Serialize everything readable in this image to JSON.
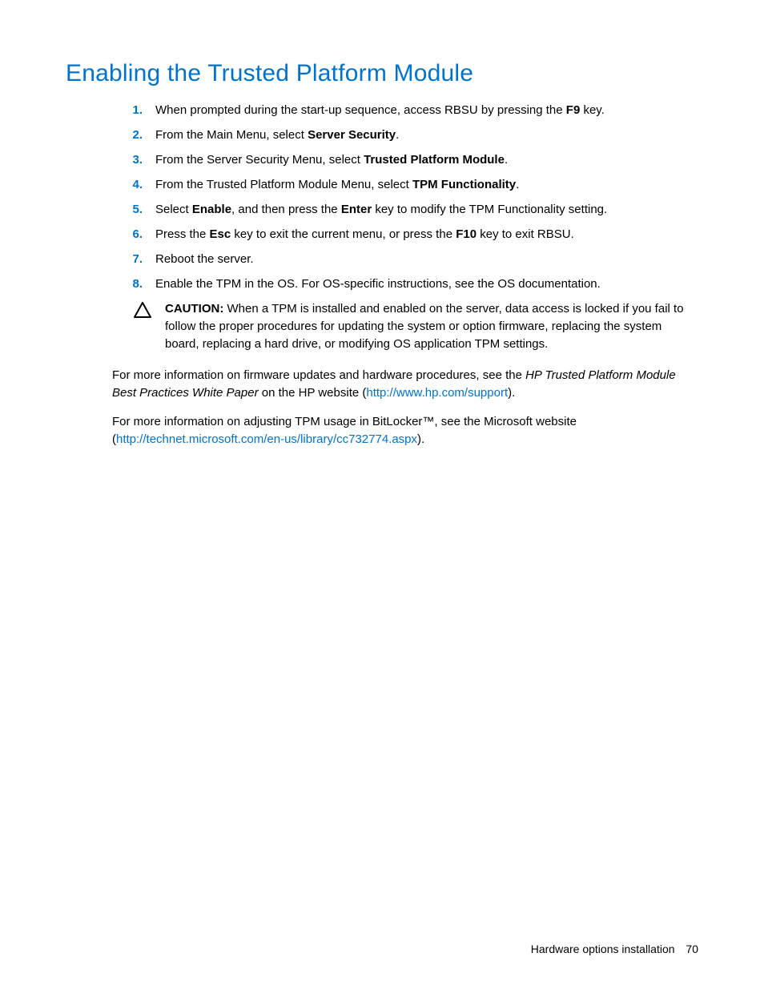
{
  "title": "Enabling the Trusted Platform Module",
  "steps": {
    "s1": {
      "num": "1.",
      "pre": "When prompted during the start-up sequence, access RBSU by pressing the ",
      "b1": "F9",
      "post": " key."
    },
    "s2": {
      "num": "2.",
      "pre": "From the Main Menu, select ",
      "b1": "Server Security",
      "post": "."
    },
    "s3": {
      "num": "3.",
      "pre": "From the Server Security Menu, select ",
      "b1": "Trusted Platform Module",
      "post": "."
    },
    "s4": {
      "num": "4.",
      "pre": "From the Trusted Platform Module Menu, select ",
      "b1": "TPM Functionality",
      "post": "."
    },
    "s5": {
      "num": "5.",
      "pre": "Select ",
      "b1": "Enable",
      "mid": ", and then press the ",
      "b2": "Enter",
      "post": " key to modify the TPM Functionality setting."
    },
    "s6": {
      "num": "6.",
      "pre": "Press the ",
      "b1": "Esc",
      "mid": " key to exit the current menu, or press the ",
      "b2": "F10",
      "post": " key to exit RBSU."
    },
    "s7": {
      "num": "7.",
      "text": "Reboot the server."
    },
    "s8": {
      "num": "8.",
      "text": "Enable the TPM in the OS. For OS-specific instructions, see the OS documentation."
    }
  },
  "caution": {
    "label": "CAUTION:",
    "text": "   When a TPM is installed and enabled on the server, data access is locked if you fail to follow the proper procedures for updating the system or option firmware, replacing the system board, replacing a hard drive, or modifying OS application TPM settings."
  },
  "para1": {
    "pre": "For more information on firmware updates and hardware procedures, see the ",
    "italic": "HP Trusted Platform Module Best Practices White Paper",
    "mid": " on the HP website (",
    "link": "http://www.hp.com/support",
    "post": ")."
  },
  "para2": {
    "pre": "For more information on adjusting TPM usage in BitLocker™, see the Microsoft website (",
    "link": "http://technet.microsoft.com/en-us/library/cc732774.aspx",
    "post": ")."
  },
  "footer": {
    "section": "Hardware options installation",
    "page": "70"
  }
}
